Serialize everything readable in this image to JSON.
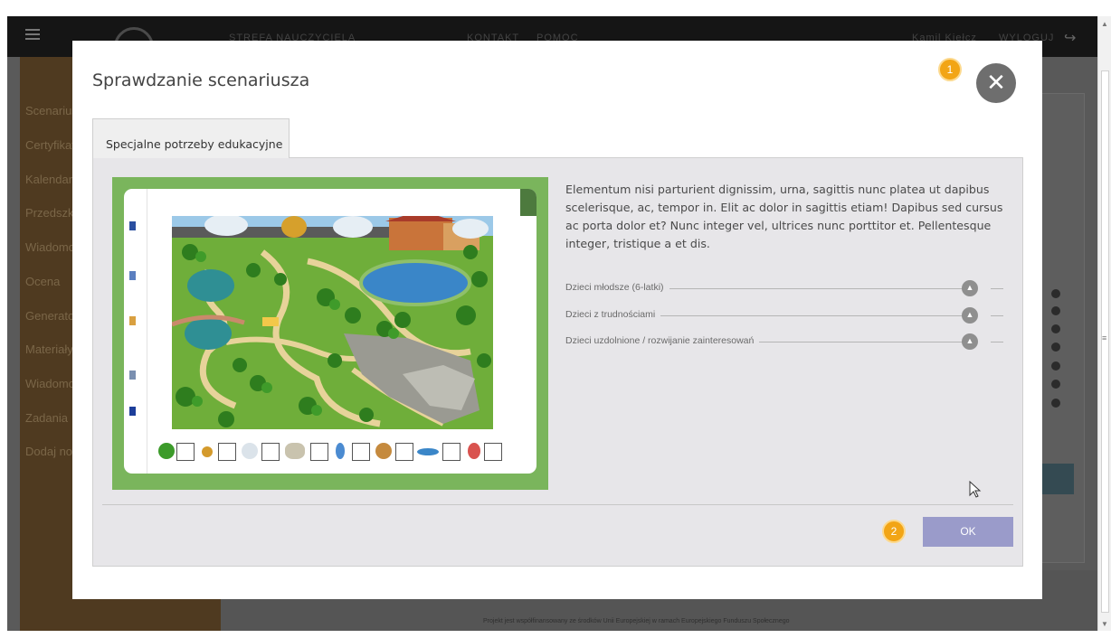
{
  "background_app": {
    "nav": [
      "STREFA NAUCZYCIELA",
      "KONTAKT",
      "POMOC"
    ],
    "user_name": "Kamil Kiełcz",
    "logout_label": "WYLOGUJ",
    "sidebar_items": [
      "Scenariusze",
      "Certyfikaty",
      "Kalendarz",
      "Przedszkole",
      "Wiadomości",
      "Ocena",
      "Generator",
      "Materiały",
      "Wiadomości",
      "Zadania",
      "Dodaj nowy"
    ],
    "footer_text": "Projekt jest współfinansowany ze środków Unii Europejskiej w ramach Europejskiego Funduszu Społecznego"
  },
  "modal": {
    "title": "Sprawdzanie scenariusza",
    "badge_1": "1",
    "badge_2": "2",
    "close_icon": "close-icon",
    "tab_label": "Specjalne potrzeby edukacyjne",
    "description": "Elementum nisi parturient dignissim, urna, sagittis nunc platea ut dapibus scelerisque, ac, tempor in. Elit ac dolor in sagittis etiam! Dapibus sed cursus ac porta dolor et? Nunc integer vel, ultrices nunc porttitor et. Pellentesque integer, tristique a et dis.",
    "accordion": [
      {
        "label": "Dzieci młodsze (6-latki)",
        "icon": "chevron-up-icon"
      },
      {
        "label": "Dzieci z trudnościami",
        "icon": "chevron-up-icon"
      },
      {
        "label": "Dzieci uzdolnione / rozwijanie zainteresowań",
        "icon": "chevron-up-icon"
      }
    ],
    "ok_label": "OK"
  },
  "colors": {
    "badge": "#f2a516",
    "ok_button": "#9a9bca",
    "picture_border": "#7ab55c",
    "close_button": "#6e6e6e"
  }
}
